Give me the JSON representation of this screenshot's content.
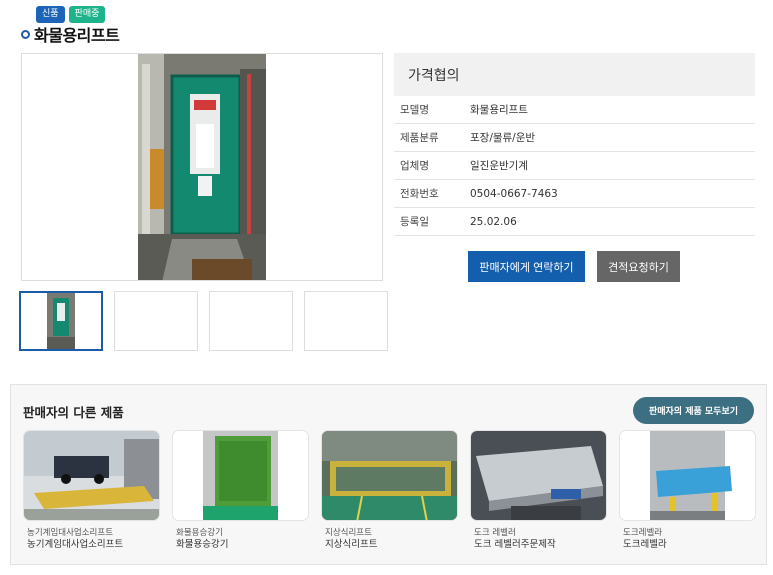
{
  "badges": {
    "new": "신품",
    "sale": "판매중"
  },
  "product": {
    "title": "화물용리프트",
    "price": "가격협의",
    "specs": [
      {
        "label": "모델명",
        "value": "화물용리프트"
      },
      {
        "label": "제품분류",
        "value": "포장/물류/운반"
      },
      {
        "label": "업체명",
        "value": "일진운반기계"
      },
      {
        "label": "전화번호",
        "value": "0504-0667-7463"
      },
      {
        "label": "등록일",
        "value": "25.02.06"
      }
    ]
  },
  "actions": {
    "contact": "판매자에게 연락하기",
    "quote": "견적요청하기"
  },
  "others": {
    "title": "판매자의 다른 제품",
    "view_all": "판매자의 제품 모두보기",
    "items": [
      {
        "category": "농기계임대사업소리프트",
        "name": "농기계임대사업소리프트"
      },
      {
        "category": "화물용승강기",
        "name": "화물용승강기"
      },
      {
        "category": "지상식리프트",
        "name": "지상식리프트"
      },
      {
        "category": "도크 레벨러",
        "name": "도크 레벨러주문제작"
      },
      {
        "category": "도크레벨라",
        "name": "도크레벨라"
      }
    ]
  }
}
